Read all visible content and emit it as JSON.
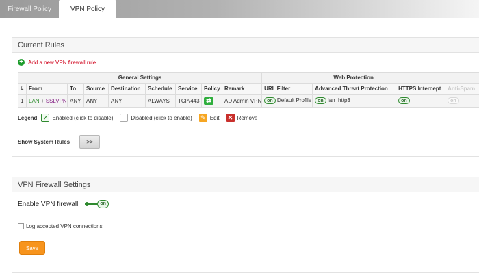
{
  "tabs": [
    {
      "label": "Firewall Policy"
    },
    {
      "label": "VPN Policy"
    }
  ],
  "current_rules": {
    "title": "Current Rules",
    "add_link": "Add a new VPN firewall rule",
    "groups": [
      "General Settings",
      "Web Protection"
    ],
    "headers": [
      "#",
      "From",
      "To",
      "Source",
      "Destination",
      "Schedule",
      "Service",
      "Policy",
      "Remark",
      "URL Filter",
      "Advanced Threat Protection",
      "HTTPS Intercept",
      "Anti-Spam"
    ],
    "rows": [
      {
        "num": "1",
        "from_lan": "LAN",
        "from_plus": "+",
        "from_ssl": "SSLVPN",
        "to": "ANY",
        "source": "ANY",
        "destination": "ANY",
        "schedule": "ALWAYS",
        "service": "TCP/443",
        "policy_icon": "arrows-swap-icon",
        "remark": "AD Admin VPN",
        "url_filter_state": "on",
        "url_filter": "Default Profile",
        "atp_state": "on",
        "atp": "lan_http3",
        "https_state": "on",
        "antispam_state": "on"
      }
    ],
    "legend": {
      "title": "Legend",
      "enabled": "Enabled (click to disable)",
      "disabled": "Disabled (click to enable)",
      "edit": "Edit",
      "remove": "Remove"
    },
    "system_rules": {
      "label": "Show System Rules",
      "button": ">>"
    }
  },
  "vpn_firewall": {
    "title": "VPN Firewall Settings",
    "enable_label": "Enable VPN firewall",
    "enable_state": "on",
    "log_label": "Log accepted VPN connections",
    "log_checked": false,
    "save": "Save"
  },
  "colors": {
    "accent_green": "#2f8a2f",
    "link_red": "#d0021b",
    "save_orange": "#f7941d"
  }
}
